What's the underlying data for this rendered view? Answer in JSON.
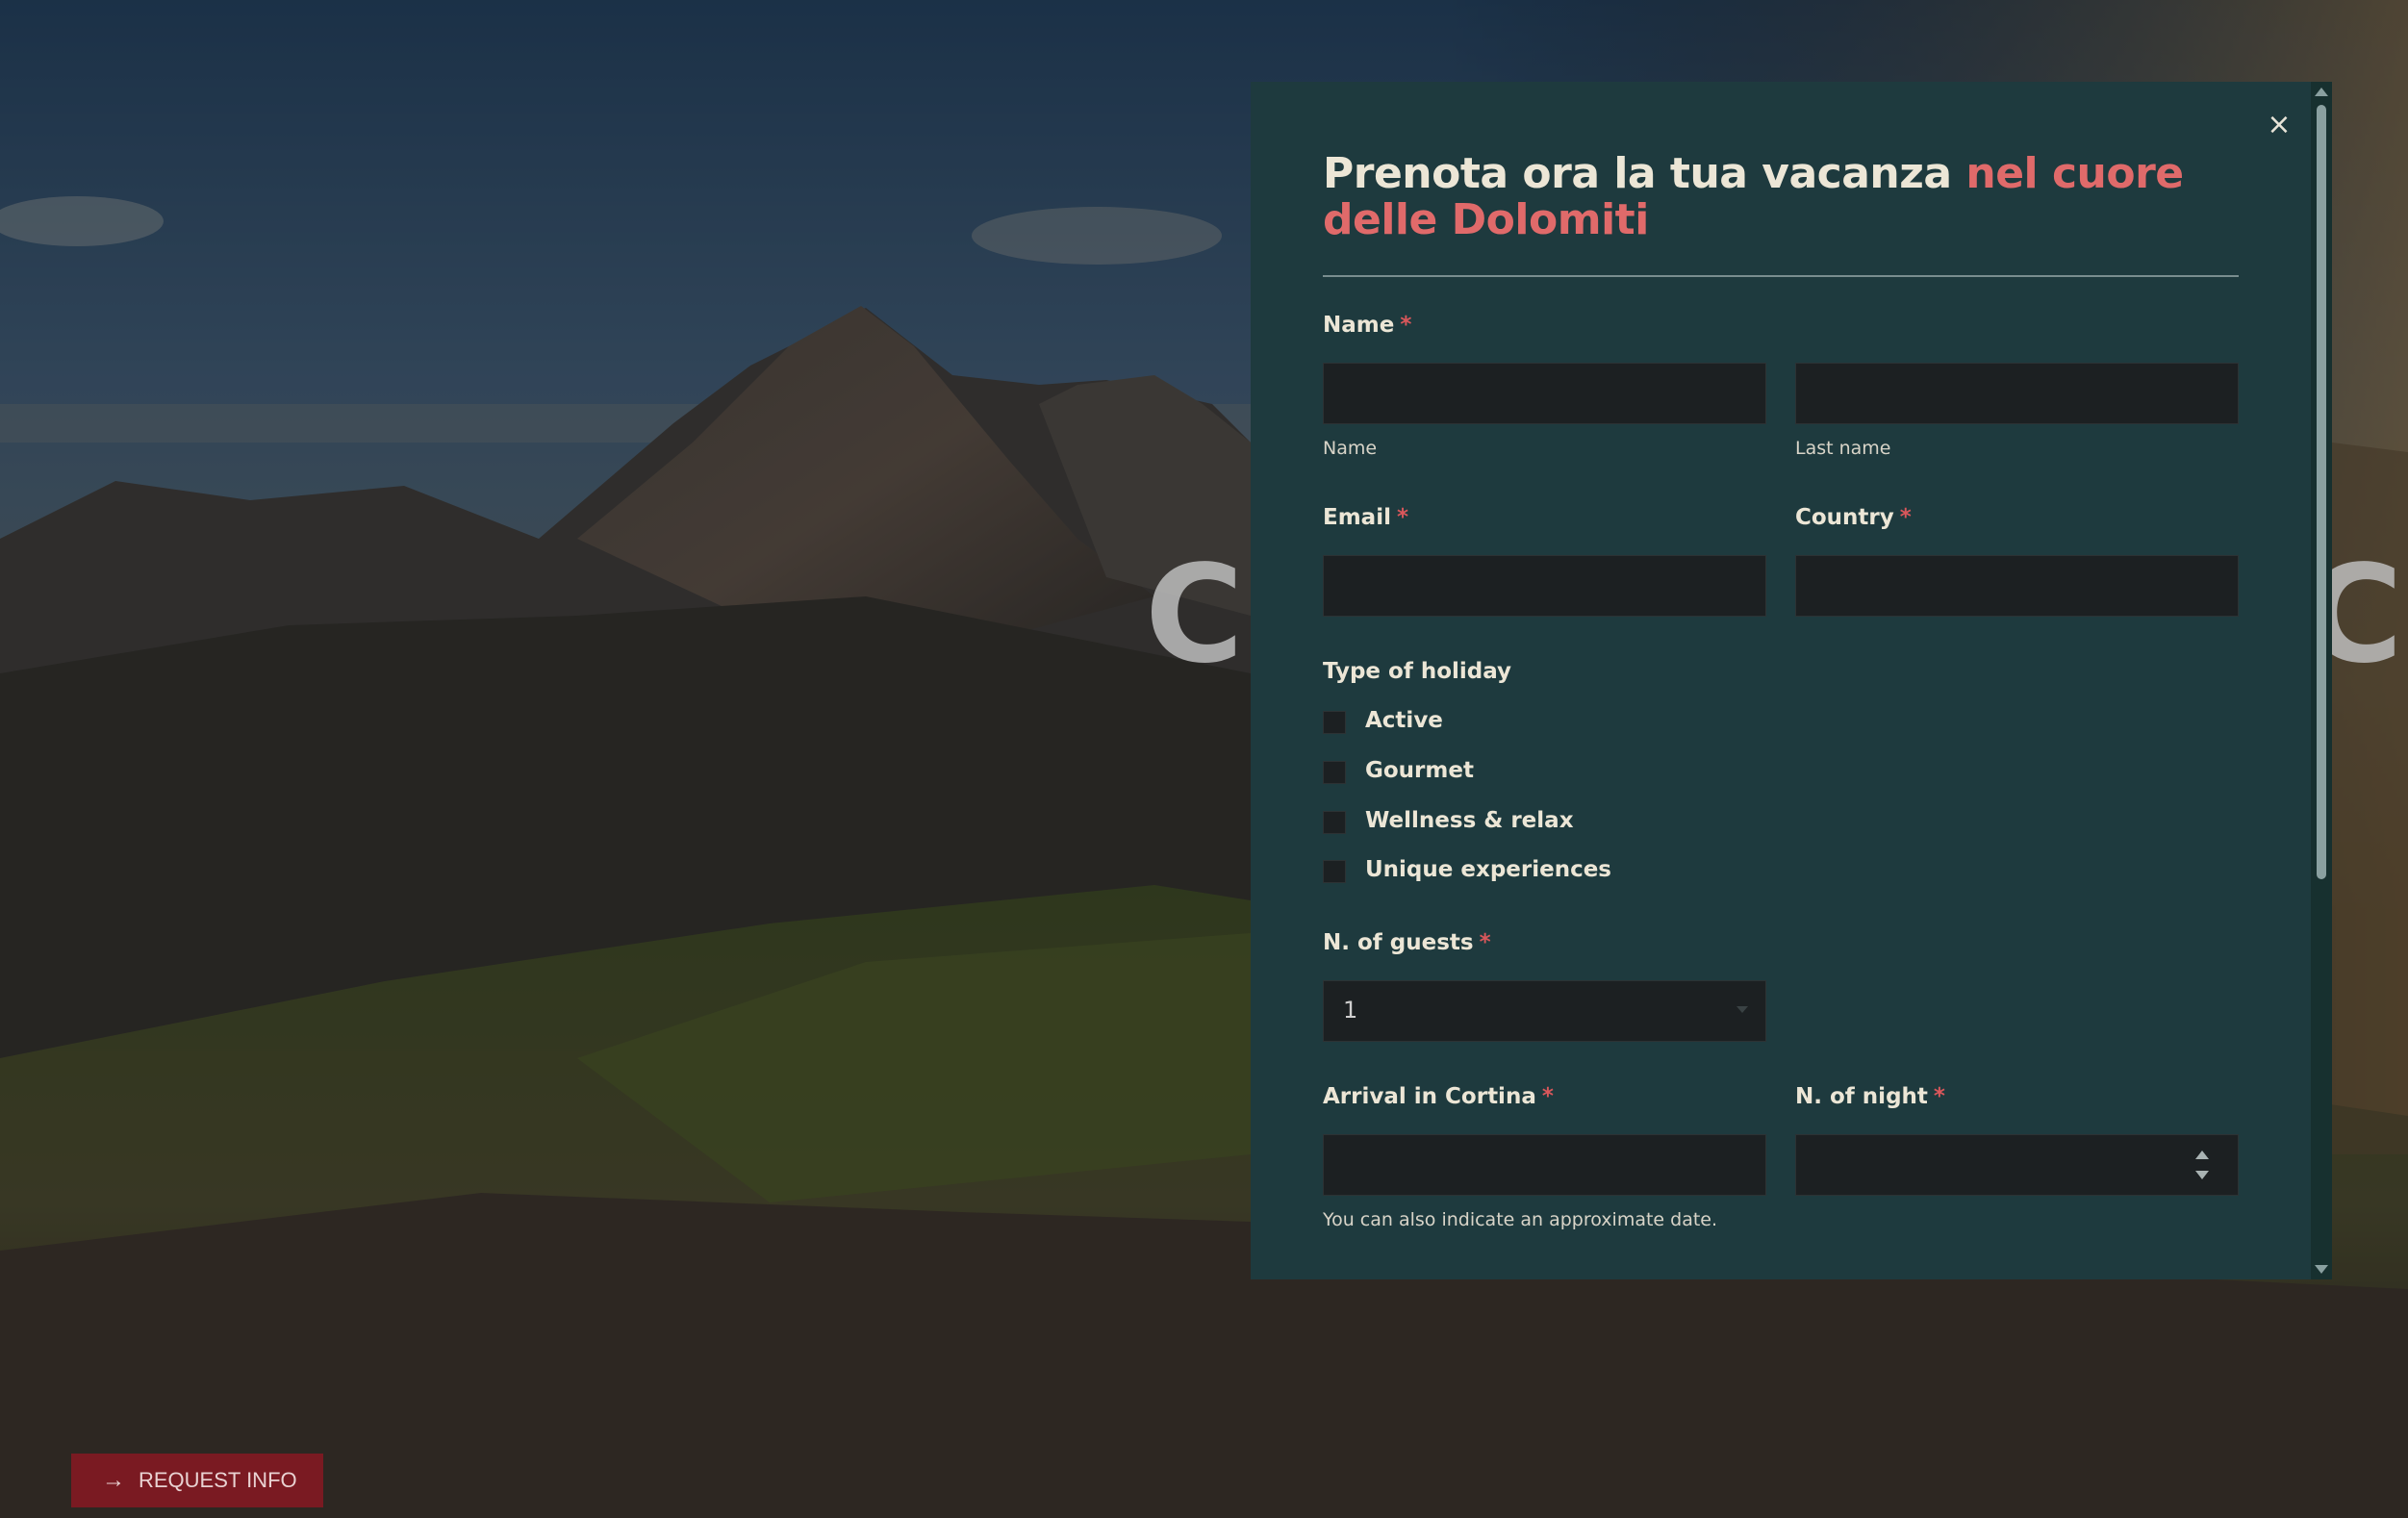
{
  "background": {
    "hero_left_text": "C",
    "hero_right_text": "C",
    "request_button": {
      "icon": "arrow-right-icon",
      "label": "REQUEST INFO"
    }
  },
  "modal": {
    "close_icon": "close-icon",
    "close_glyph": "×",
    "title_main": "Prenota ora la tua vacanza ",
    "title_accent": "nel cuore delle Dolomiti",
    "required_mark": "*",
    "name": {
      "label": "Name",
      "first_sublabel": "Name",
      "last_sublabel": "Last name",
      "first_value": "",
      "last_value": ""
    },
    "email": {
      "label": "Email",
      "value": ""
    },
    "country": {
      "label": "Country",
      "value": ""
    },
    "holiday": {
      "label": "Type of holiday",
      "options": [
        "Active",
        "Gourmet",
        "Wellness & relax",
        "Unique experiences"
      ]
    },
    "guests": {
      "label": "N. of guests",
      "value": "1"
    },
    "arrival": {
      "label": "Arrival in Cortina",
      "value": "",
      "hint": "You can also indicate an approximate date."
    },
    "nights": {
      "label": "N. of night",
      "value": ""
    }
  },
  "colors": {
    "modal_bg": "#1e3a3e",
    "accent": "#e06a6a",
    "required": "#d9575b",
    "button_bg": "#7a1a22",
    "input_bg": "#1c2022"
  }
}
